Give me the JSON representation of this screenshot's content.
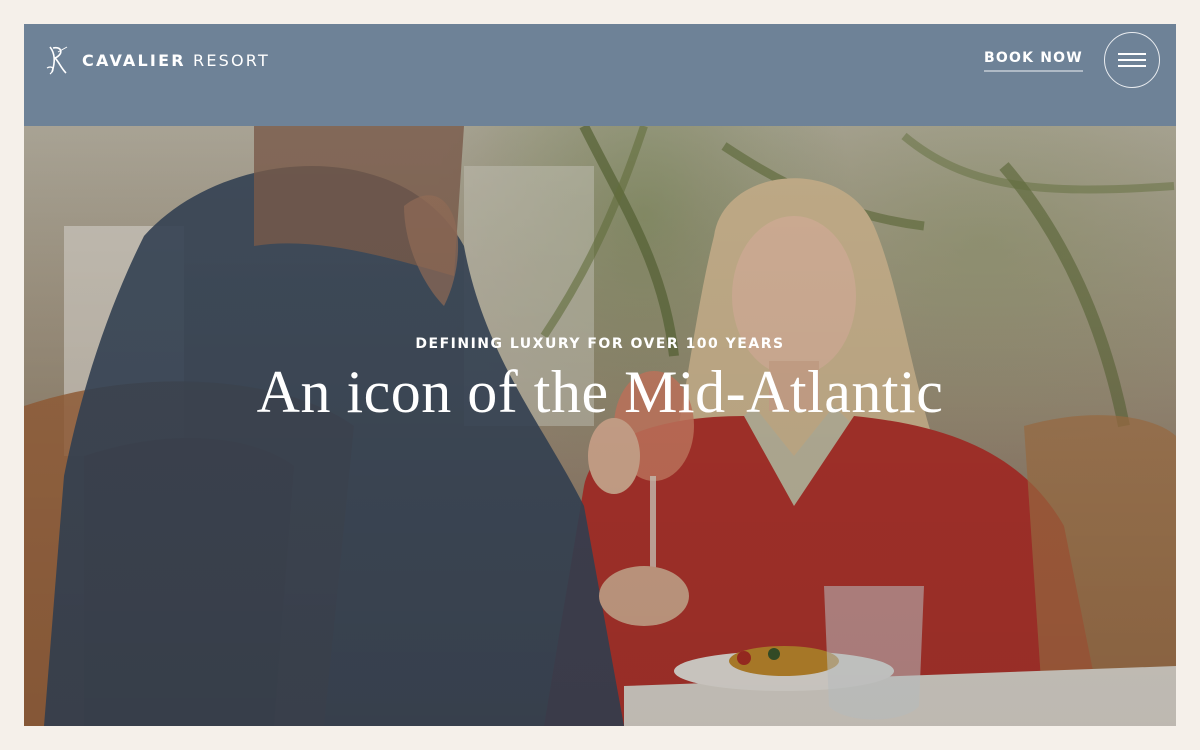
{
  "header": {
    "logo_bold": "CAVALIER",
    "logo_light": "RESORT",
    "book_now_label": "BOOK NOW",
    "menu_icon": "hamburger-icon",
    "logo_icon": "cavalier-monogram-icon"
  },
  "hero": {
    "eyebrow": "DEFINING LUXURY FOR OVER 100 YEARS",
    "title": "An icon of the Mid-Atlantic"
  },
  "colors": {
    "page_background": "#f5f0ea",
    "header_background": "#6e8297",
    "text": "#ffffff"
  }
}
